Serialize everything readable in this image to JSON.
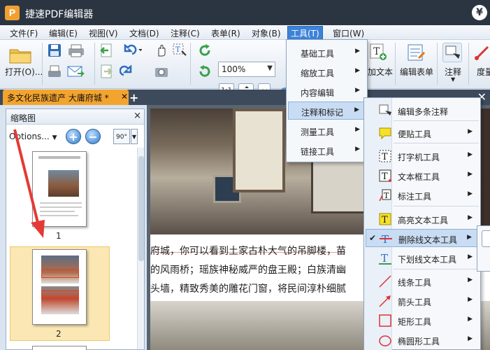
{
  "app": {
    "logo": "P",
    "title": "捷速PDF编辑器",
    "right_icon": "¥"
  },
  "menubar": {
    "items": [
      "文件(F)",
      "编辑(E)",
      "视图(V)",
      "文档(D)",
      "注释(C)",
      "表单(R)",
      "对象(B)",
      "工具(T)",
      "窗口(W)"
    ],
    "active": "工具(T)"
  },
  "toolbar": {
    "open_label": "打开(O)...",
    "zoom_value": "100%",
    "one_to_one": "1:1",
    "add_text_label": "加文本",
    "edit_form_label": "编辑表单",
    "annotate_label": "注释",
    "measure_label": "度量"
  },
  "tabs": {
    "doc_tab": "多文化民族遗产 大庸府城 *"
  },
  "thumbnails": {
    "title": "缩略图",
    "options_label": "Options...",
    "zoom_in": "+",
    "zoom_out": "−",
    "rotate_label": "90°",
    "pages": [
      "1",
      "2"
    ]
  },
  "document": {
    "lines": [
      "府城，你可以看到土家古朴大气的吊脚楼，苗",
      "的风雨桥；瑶族神秘威严的盘王殿；白族清幽",
      "头墙，精致秀美的雕花门窗，将民间淳朴细腻"
    ]
  },
  "menu_tools": {
    "items": [
      {
        "label": "基础工具"
      },
      {
        "label": "缩放工具"
      },
      {
        "label": "内容编辑"
      },
      {
        "label": "注释和标记",
        "highlighted": true
      },
      {
        "label": "测量工具"
      },
      {
        "label": "链接工具"
      }
    ]
  },
  "menu_annotations": {
    "items": [
      {
        "label": "编辑多条注释",
        "icon": "multi-annotation-icon",
        "submenu": false
      },
      {
        "label": "便贴工具",
        "icon": "sticky-note-icon",
        "submenu": true
      },
      {
        "label": "打字机工具",
        "icon": "typewriter-icon",
        "submenu": true
      },
      {
        "label": "文本框工具",
        "icon": "textbox-icon",
        "submenu": true
      },
      {
        "label": "标注工具",
        "icon": "callout-icon",
        "submenu": true
      },
      {
        "label": "高亮文本工具",
        "icon": "highlight-text-icon",
        "submenu": true
      },
      {
        "label": "删除线文本工具",
        "icon": "strikeout-text-icon",
        "submenu": true,
        "checked": true,
        "highlighted": true
      },
      {
        "label": "下划线文本工具",
        "icon": "underline-text-icon",
        "submenu": true
      },
      {
        "label": "线条工具",
        "icon": "line-icon",
        "submenu": true
      },
      {
        "label": "箭头工具",
        "icon": "arrow-icon",
        "submenu": true
      },
      {
        "label": "矩形工具",
        "icon": "rectangle-icon",
        "submenu": true
      },
      {
        "label": "椭圆形工具",
        "icon": "ellipse-icon",
        "submenu": true
      }
    ]
  },
  "colors": {
    "titlebar": "#2b3542",
    "accent": "#3c82d8",
    "tab": "#f3a42e",
    "menu_highlight": "#c8dcf3",
    "arrow": "#e53935"
  }
}
